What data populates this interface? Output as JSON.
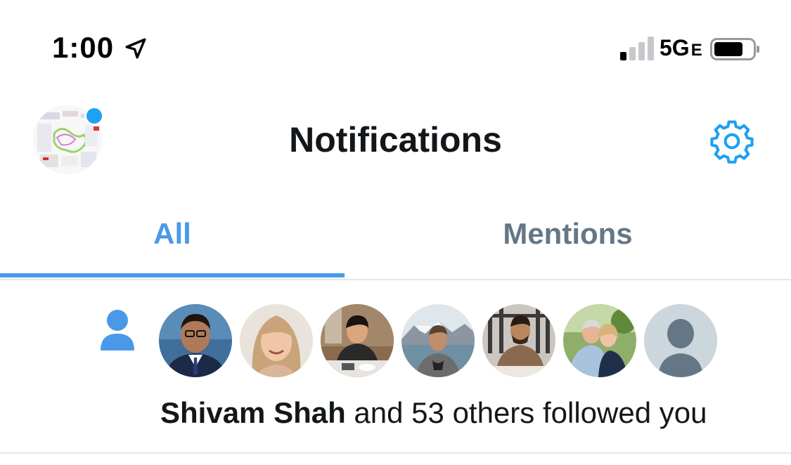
{
  "status_bar": {
    "time": "1:00",
    "network": "5G",
    "network_suffix": "E",
    "icons": [
      "location-arrow-icon",
      "signal-icon",
      "battery-icon"
    ]
  },
  "header": {
    "title": "Notifications",
    "settings_icon": "gear-icon"
  },
  "tabs": [
    {
      "label": "All",
      "active": true
    },
    {
      "label": "Mentions",
      "active": false
    }
  ],
  "notification": {
    "type_icon": "person-icon",
    "name": "Shivam Shah",
    "rest": " and 53 others followed you",
    "avatars": [
      "avatar-1",
      "avatar-2",
      "avatar-3",
      "avatar-4",
      "avatar-5",
      "avatar-6",
      "avatar-default"
    ]
  },
  "colors": {
    "accent": "#4a99e9",
    "muted": "#657786",
    "text": "#14171a",
    "divider": "#e1e8ed"
  }
}
